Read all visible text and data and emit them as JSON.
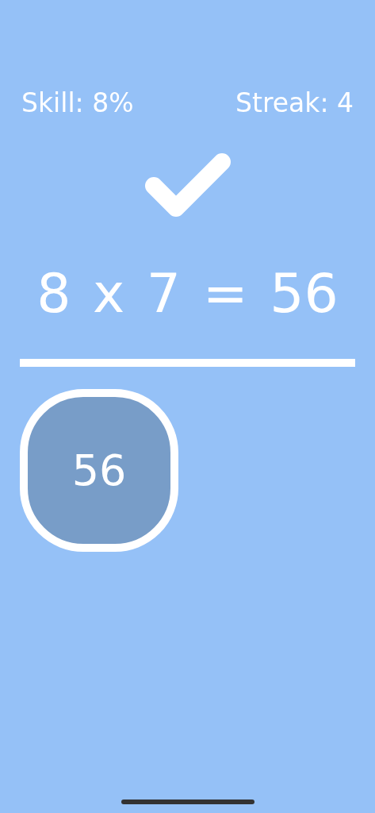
{
  "stats": [
    {
      "text": "Skill: 8%"
    },
    {
      "text": "Streak: 4"
    }
  ],
  "feedback": {
    "correct": true
  },
  "equation": "8 x 7 = 56",
  "answers": [
    {
      "label": "56"
    }
  ]
}
